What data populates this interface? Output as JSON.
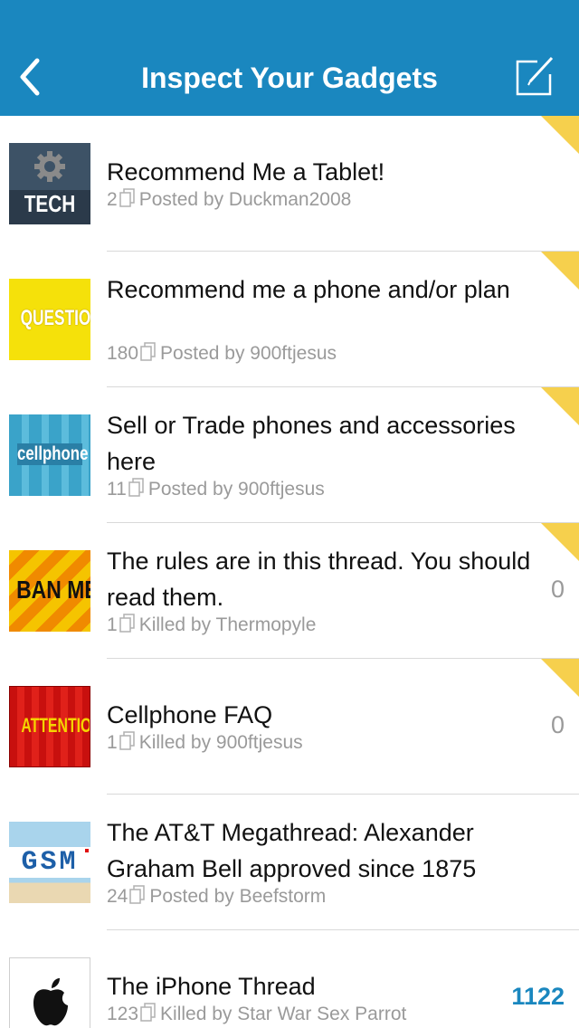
{
  "nav": {
    "title": "Inspect Your Gadgets",
    "back_icon": "chevron-left-icon",
    "compose_icon": "compose-icon",
    "bar_color": "#1a87bf"
  },
  "threads": [
    {
      "icon_text": "TECH",
      "title": "Recommend Me a Tablet!",
      "pages": "2",
      "byline": "Posted by Duckman2008",
      "unread": "",
      "bookmarked": true
    },
    {
      "icon_text": "QUESTION",
      "title": "Recommend me a phone and/or plan",
      "pages": "180",
      "byline": "Posted by 900ftjesus",
      "unread": "",
      "bookmarked": true
    },
    {
      "icon_text": "cellphone",
      "title": "Sell or Trade phones and accessories here",
      "pages": "11",
      "byline": "Posted by 900ftjesus",
      "unread": "",
      "bookmarked": true
    },
    {
      "icon_text": "BAN ME",
      "title": "The rules are in this thread. You should read them.",
      "pages": "1",
      "byline": "Killed by Thermopyle",
      "unread": "0",
      "bookmarked": true
    },
    {
      "icon_text": "ATTENTION",
      "title": "Cellphone FAQ",
      "pages": "1",
      "byline": "Killed by 900ftjesus",
      "unread": "0",
      "bookmarked": true
    },
    {
      "icon_text": "GSM",
      "title": "The AT&T Megathread: Alexander Graham Bell approved since 1875",
      "pages": "24",
      "byline": "Posted by Beefstorm",
      "unread": "",
      "bookmarked": false
    },
    {
      "icon_text": "",
      "title": "The iPhone Thread",
      "pages": "123",
      "byline": "Killed by Star War Sex Parrot",
      "unread": "1122",
      "bookmarked": false
    }
  ],
  "colors": {
    "bookmark_corner": "#f6d04d",
    "unread_active": "#1a87bf"
  }
}
